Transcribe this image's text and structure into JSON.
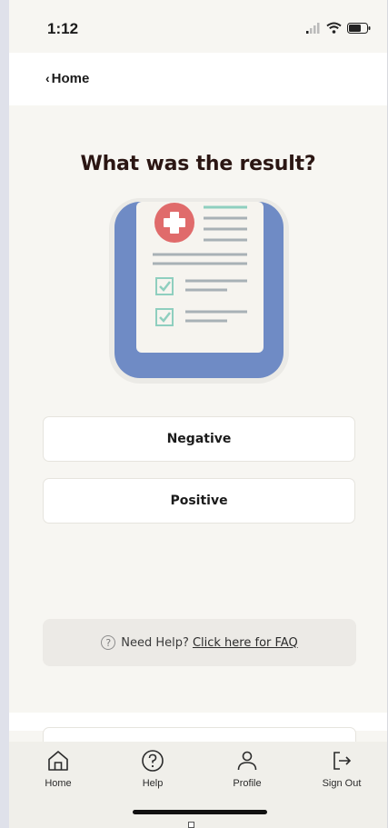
{
  "status_bar": {
    "time": "1:12"
  },
  "nav": {
    "back_label": "Home"
  },
  "title": "What was the result?",
  "options": [
    {
      "label": "Negative"
    },
    {
      "label": "Positive"
    }
  ],
  "help": {
    "text": "Need Help?",
    "link": "Click here for FAQ"
  },
  "tab_bar": [
    {
      "label": "Home",
      "icon": "home-icon"
    },
    {
      "label": "Help",
      "icon": "help-circle-icon"
    },
    {
      "label": "Profile",
      "icon": "person-icon"
    },
    {
      "label": "Sign Out",
      "icon": "sign-out-icon"
    }
  ],
  "colors": {
    "accent_blue": "#6f8bc5",
    "cross_red": "#e06b6b",
    "check_teal": "#8fcfbf",
    "background": "#f7f6f2"
  }
}
